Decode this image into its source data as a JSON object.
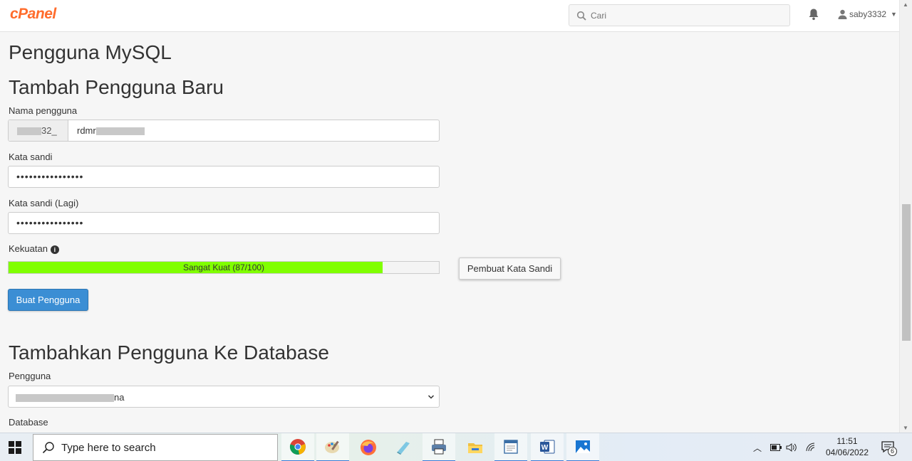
{
  "header": {
    "logo": "cPanel",
    "search_placeholder": "Cari",
    "username": "saby3332"
  },
  "page": {
    "title": "Pengguna MySQL",
    "add_user_heading": "Tambah Pengguna Baru",
    "username_label": "Nama pengguna",
    "username_prefix_visible": "32_",
    "username_value_visible": "rdmr",
    "password_label": "Kata sandi",
    "password_value": "••••••••••••••••",
    "password_again_label": "Kata sandi (Lagi)",
    "password_again_value": "••••••••••••••••",
    "strength_label": "Kekuatan",
    "strength_text": "Sangat Kuat (87/100)",
    "strength_score": 87,
    "strength_color": "#80ff00",
    "generator_button": "Pembuat Kata Sandi",
    "create_button": "Buat Pengguna",
    "add_to_db_heading": "Tambahkan Pengguna Ke Database",
    "user_select_label": "Pengguna",
    "user_select_value_visible": "na",
    "database_label": "Database"
  },
  "taskbar": {
    "search_placeholder": "Type here to search",
    "apps": [
      "chrome-icon",
      "paint-icon",
      "firefox-icon",
      "notepad-icon",
      "print-icon",
      "file-explorer-icon",
      "window-app-icon",
      "word-icon",
      "photos-icon"
    ],
    "time": "11:51",
    "date": "04/06/2022",
    "notification_count": "6"
  },
  "colors": {
    "accent": "#3b8ed4",
    "logo": "#ff6c2c"
  }
}
